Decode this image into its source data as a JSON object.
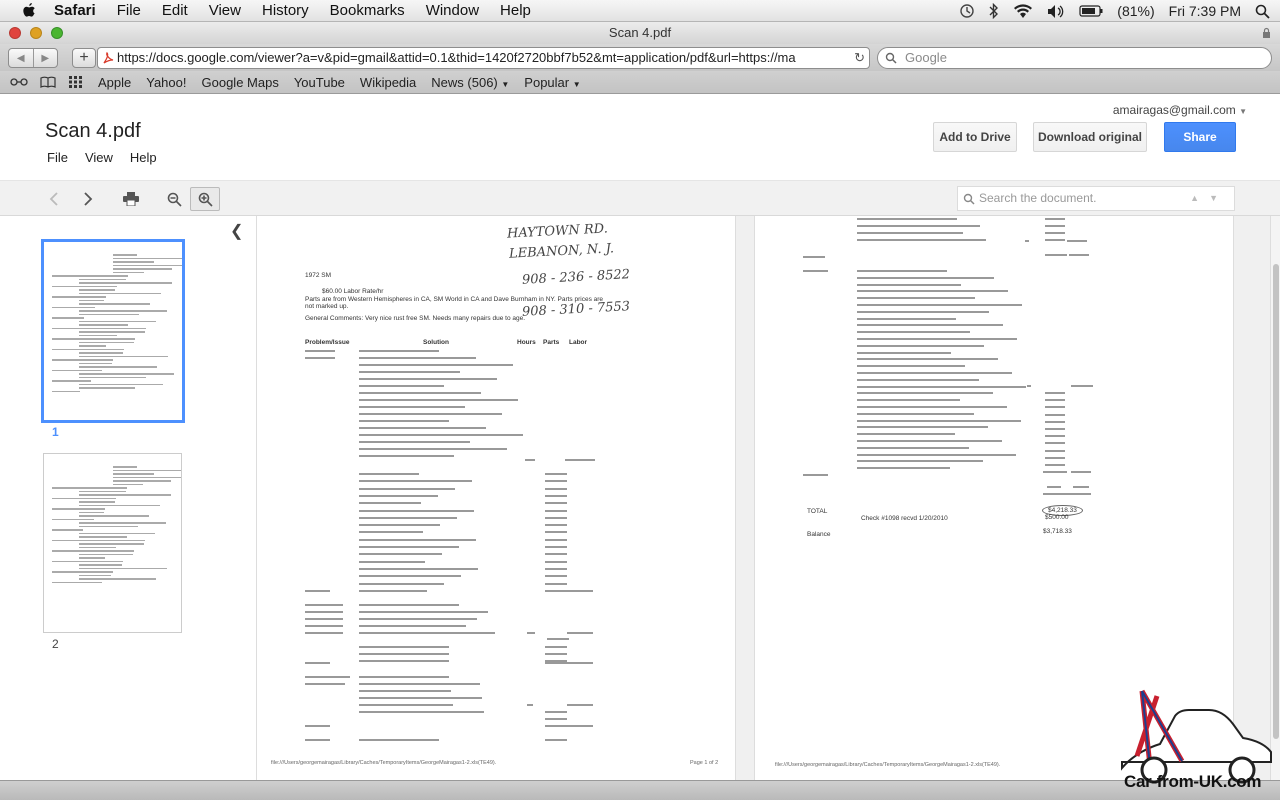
{
  "menubar": {
    "app": "Safari",
    "items": [
      "File",
      "Edit",
      "View",
      "History",
      "Bookmarks",
      "Window",
      "Help"
    ],
    "battery": "(81%)",
    "clock": "Fri 7:39 PM"
  },
  "window": {
    "title": "Scan 4.pdf"
  },
  "toolbar": {
    "url": "https://docs.google.com/viewer?a=v&pid=gmail&attid=0.1&thid=1420f2720bbf7b52&mt=application/pdf&url=https://ma",
    "search_placeholder": "Google"
  },
  "bookmarks": [
    "Apple",
    "Yahoo!",
    "Google Maps",
    "YouTube",
    "Wikipedia",
    "News (506)",
    "Popular"
  ],
  "viewer": {
    "account": "amairagas@gmail.com",
    "doc_title": "Scan 4.pdf",
    "menu": [
      "File",
      "View",
      "Help"
    ],
    "add_to_drive": "Add to Drive",
    "download": "Download original",
    "share": "Share",
    "search_placeholder": "Search the document.",
    "pages": [
      "1",
      "2"
    ]
  },
  "page1": {
    "handwriting": [
      "HAYTOWN RD.",
      "LEBANON, N. J.",
      "908 - 236 - 8522",
      "908 - 310 - 7553"
    ],
    "model": "1972 SM",
    "rate_line": "$60.00        Labor Rate/hr",
    "parts_line": "Parts are from Western Hemispheres in CA, SM World in CA and Dave Burnham in NY. Parts prices are",
    "parts_line2": "not marked up.",
    "comments": "General Comments: Very nice rust free SM. Needs many repairs due to age.",
    "headers": [
      "Problem/Issue",
      "Solution",
      "Hours",
      "Parts",
      "Labor"
    ],
    "footer": "file:///Users/georgemairagas/Library/Caches/TemporaryItems/GeorgeMairagas1-2.xls(TE49).",
    "footer_page": "Page 1 of 2"
  },
  "page2": {
    "footer": "file:///Users/georgemairagas/Library/Caches/TemporaryItems/GeorgeMairagas1-2.xls(TE49).",
    "total_label": "TOTAL",
    "total_value": "$4,218.33",
    "check": "Check #1098 recvd 1/20/2010",
    "check_value": "$500.00",
    "balance_label": "Balance",
    "balance_value": "$3,718.33"
  },
  "watermark": "Car-from-UK.com"
}
